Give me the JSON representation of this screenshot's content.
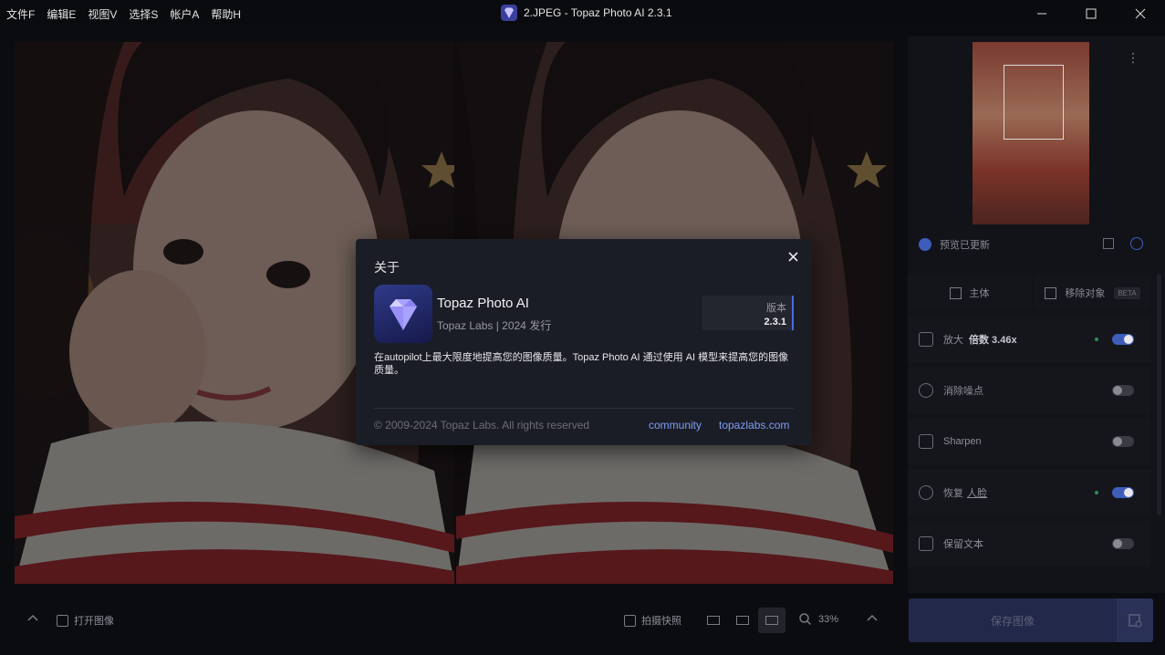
{
  "menu": [
    "文件F",
    "编辑E",
    "视图V",
    "选择S",
    "帐户A",
    "帮助H"
  ],
  "window": {
    "title": "2.JPEG - Topaz Photo AI 2.3.1"
  },
  "preview": {
    "status": "预览已更新"
  },
  "modes": {
    "subject": "主体",
    "remove_object": "移除对象",
    "beta_badge": "BETA"
  },
  "features": [
    {
      "label": "放大",
      "detail": "倍数 3.46x",
      "enabled": true
    },
    {
      "label": "消除噪点",
      "enabled": false
    },
    {
      "label": "Sharpen",
      "enabled": false
    },
    {
      "label": "恢复",
      "detail": "人脸",
      "enabled": true
    },
    {
      "label": "保留文本",
      "enabled": false
    }
  ],
  "bottom": {
    "open_image": "打开图像",
    "snapshot": "拍摄快照",
    "zoom": "33%",
    "save": "保存图像"
  },
  "about": {
    "title": "关于",
    "product_name": "Topaz Photo AI",
    "publisher": "Topaz Labs | 2024 发行",
    "version_label": "版本",
    "version": "2.3.1",
    "description": "在autopilot上最大限度地提高您的图像质量。Topaz Photo AI 通过使用 AI 模型来提高您的图像质量。",
    "copyright": "© 2009-2024 Topaz Labs. All rights reserved",
    "link_community": "community",
    "link_site": "topazlabs.com"
  },
  "colors": {
    "accent": "#3e5dbb",
    "link": "#7f9ef2",
    "modal_bg": "#1b1d26"
  }
}
